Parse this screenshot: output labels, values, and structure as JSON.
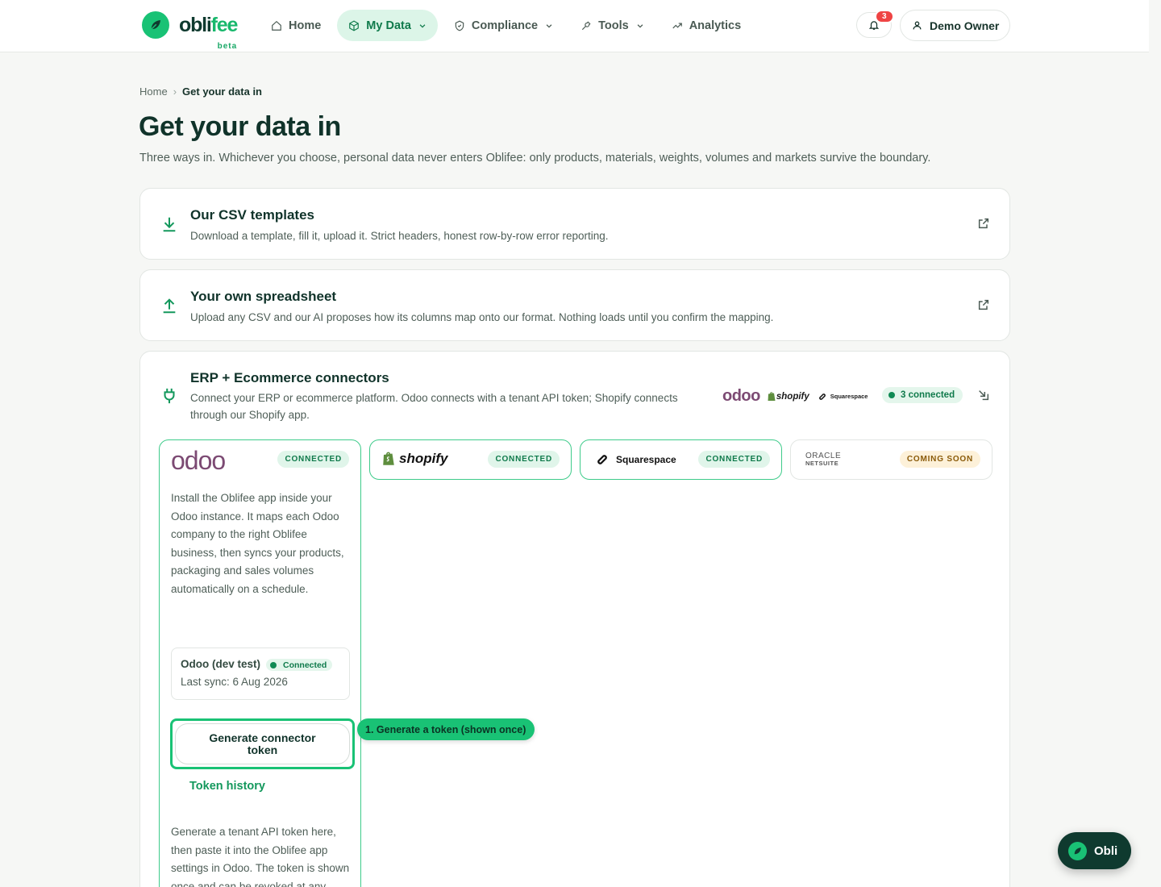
{
  "brand": {
    "name_a": "obli",
    "name_b": "fee",
    "tag": "beta"
  },
  "nav": {
    "home": "Home",
    "my_data": "My Data",
    "compliance": "Compliance",
    "tools": "Tools",
    "analytics": "Analytics"
  },
  "header": {
    "notifications_count": "3",
    "user_name": "Demo Owner"
  },
  "breadcrumb": {
    "home": "Home",
    "current": "Get your data in"
  },
  "page": {
    "title": "Get your data in",
    "subtitle": "Three ways in. Whichever you choose, personal data never enters Oblifee: only products, materials, weights, volumes and markets survive the boundary."
  },
  "cards": {
    "csv": {
      "title": "Our CSV templates",
      "desc": "Download a template, fill it, upload it. Strict headers, honest row-by-row error reporting."
    },
    "spreadsheet": {
      "title": "Your own spreadsheet",
      "desc": "Upload any CSV and our AI proposes how its columns map onto our format. Nothing loads until you confirm the mapping."
    },
    "connectors": {
      "title": "ERP + Ecommerce connectors",
      "desc": "Connect your ERP or ecommerce platform. Odoo connects with a tenant API token; Shopify connects through our Shopify app.",
      "brand_odoo": "odoo",
      "brand_shopify": "shopify",
      "brand_squarespace": "Squarespace",
      "connected_summary": "3 connected"
    }
  },
  "tiles": {
    "odoo": {
      "logo": "odoo",
      "status": "CONNECTED",
      "desc": "Install the Oblifee app inside your Odoo instance. It maps each Odoo company to the right Oblifee business, then syncs your products, packaging and sales volumes automatically on a schedule.",
      "instance_name": "Odoo (dev test)",
      "instance_status": "Connected",
      "last_sync": "Last sync: 6 Aug 2026",
      "generate_button": "Generate connector token",
      "token_history": "Token history",
      "help": "Generate a tenant API token here, then paste it into the Oblifee app settings in Odoo. The token is shown once and can be revoked at any time."
    },
    "shopify": {
      "logo": "shopify",
      "status": "CONNECTED"
    },
    "squarespace": {
      "logo": "Squarespace",
      "status": "CONNECTED"
    },
    "oracle": {
      "logo_a": "ORACLE",
      "logo_b": "NETSUITE",
      "status": "COMING SOON"
    }
  },
  "tooltip": {
    "text": "1. Generate a token (shown once)"
  },
  "assistant": {
    "label": "Obli"
  },
  "colors": {
    "accent": "#19c275",
    "brand_dark": "#0f3a2f",
    "odoo_purple": "#7c4a73"
  }
}
